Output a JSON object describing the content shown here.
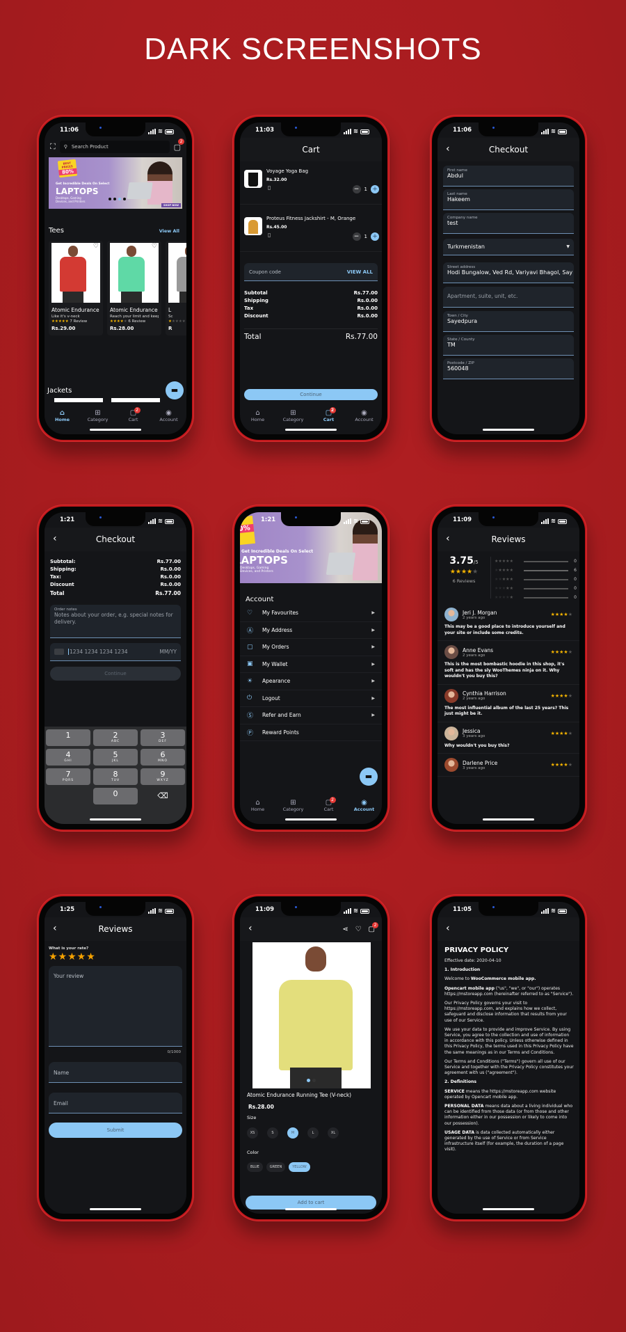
{
  "title": "DARK SCREENSHOTS",
  "colors": {
    "background": "#a81c1f",
    "accent": "#8cc8f5",
    "badge": "#e53935",
    "star": "#f5b400"
  },
  "nav": {
    "home": "Home",
    "category": "Category",
    "cart": "Cart",
    "account": "Account",
    "cart_badge": "2"
  },
  "home": {
    "time": "11:06",
    "search_placeholder": "Search Product",
    "cart_badge": "2",
    "banner": {
      "tag": "BEST PRICES",
      "discount": "80%",
      "headline": "Get Incredible Deals On Select",
      "title": "LAPTOPS",
      "sub": "Desktops, Gaming Devices, and Printers",
      "cta": "SHOP NOW",
      "active_dot": 3,
      "dots": 4
    },
    "section_tees": "Tees",
    "view_all": "View All",
    "section_jackets": "Jackets",
    "products": [
      {
        "name": "Atomic Endurance",
        "desc": "Like it's v-neck",
        "rating": 4.5,
        "reviews": "7 Review",
        "price": "Rs.29.00",
        "color": "#d33a33"
      },
      {
        "name": "Atomic Endurance",
        "desc": "Reach your limit and keep",
        "rating": 4,
        "reviews": "6 Review",
        "price": "Rs.28.00",
        "color": "#5fd9a6"
      },
      {
        "name": "L",
        "desc": "Sc",
        "rating": 1,
        "reviews": "",
        "price": "R",
        "color": "#999"
      }
    ]
  },
  "cart": {
    "time": "11:03",
    "title": "Cart",
    "items": [
      {
        "name": "Voyage Yoga Bag",
        "price": "Rs.32.00",
        "qty": "1"
      },
      {
        "name": "Proteus Fitness Jackshirt - M, Orange",
        "price": "Rs.45.00",
        "qty": "1"
      }
    ],
    "coupon_placeholder": "Coupon code",
    "coupon_view_all": "VIEW ALL",
    "summary": [
      {
        "label": "Subtotal",
        "value": "Rs.77.00"
      },
      {
        "label": "Shipping",
        "value": "Rs.0.00"
      },
      {
        "label": "Tax",
        "value": "Rs.0.00"
      },
      {
        "label": "Discount",
        "value": "Rs.0.00"
      }
    ],
    "total_label": "Total",
    "total_value": "Rs.77.00",
    "continue": "Continue"
  },
  "checkout_address": {
    "time": "11:06",
    "title": "Checkout",
    "fields": [
      {
        "label": "First name",
        "value": "Abdul"
      },
      {
        "label": "Last name",
        "value": "Hakeem"
      },
      {
        "label": "Company name",
        "value": "test"
      }
    ],
    "country": "Turkmenistan",
    "street_label": "Street address",
    "street_value": "Hodi Bungalow, Ved Rd, Variyavi Bhagol, Say",
    "apartment_placeholder": "Apartment, suite, unit, etc.",
    "fields2": [
      {
        "label": "Town / City",
        "value": "Sayedpura"
      },
      {
        "label": "State / County",
        "value": "TM"
      },
      {
        "label": "Postcode / ZIP",
        "value": "560048"
      }
    ]
  },
  "checkout_payment": {
    "time": "1:21",
    "title": "Checkout",
    "summary": [
      {
        "label": "Subtotal:",
        "value": "Rs.77.00"
      },
      {
        "label": "Shipping:",
        "value": "Rs.0.00"
      },
      {
        "label": "Tax:",
        "value": "Rs.0.00"
      },
      {
        "label": "Discount",
        "value": "Rs.0.00"
      },
      {
        "label": "Total",
        "value": "Rs.77.00"
      }
    ],
    "notes_label": "Order notes",
    "notes_placeholder": "Notes about your order, e.g. special notes for delivery.",
    "card_placeholder": "1234 1234 1234 1234",
    "expiry_placeholder": "MM/YY",
    "continue": "Continue",
    "keys": [
      [
        {
          "n": "1",
          "l": ""
        },
        {
          "n": "2",
          "l": "ABC"
        },
        {
          "n": "3",
          "l": "DEF"
        }
      ],
      [
        {
          "n": "4",
          "l": "GHI"
        },
        {
          "n": "5",
          "l": "JKL"
        },
        {
          "n": "6",
          "l": "MNO"
        }
      ],
      [
        {
          "n": "7",
          "l": "PQRS"
        },
        {
          "n": "8",
          "l": "TUV"
        },
        {
          "n": "9",
          "l": "WXYZ"
        }
      ],
      [
        {
          "n": "",
          "l": ""
        },
        {
          "n": "0",
          "l": ""
        },
        {
          "n": "⌫",
          "l": ""
        }
      ]
    ]
  },
  "account": {
    "time": "1:21",
    "heading": "Account",
    "items": [
      {
        "label": "My Favourites",
        "icon": "heart-icon",
        "glyph": "♡"
      },
      {
        "label": "My Address",
        "icon": "address-icon",
        "glyph": "Ⓐ"
      },
      {
        "label": "My Orders",
        "icon": "bag-icon",
        "glyph": "▢"
      },
      {
        "label": "My Wallet",
        "icon": "wallet-icon",
        "glyph": "▣"
      },
      {
        "label": "Apearance",
        "icon": "sun-icon",
        "glyph": "☀"
      },
      {
        "label": "Logout",
        "icon": "power-icon",
        "glyph": "⏻"
      },
      {
        "label": "Refer and Earn",
        "icon": "dollar-icon",
        "glyph": "Ⓢ"
      },
      {
        "label": "Reward Points",
        "icon": "points-icon",
        "glyph": "Ⓟ"
      }
    ]
  },
  "reviews_list": {
    "time": "11:09",
    "title": "Reviews",
    "average": "3.75",
    "out_of": "/5",
    "average_stars": 4,
    "count_label": "6 Reviews",
    "distribution": [
      {
        "stars": 5,
        "count": "0",
        "fraction": 0
      },
      {
        "stars": 4,
        "count": "6",
        "fraction": 1
      },
      {
        "stars": 3,
        "count": "0",
        "fraction": 0
      },
      {
        "stars": 2,
        "count": "0",
        "fraction": 0
      },
      {
        "stars": 1,
        "count": "0",
        "fraction": 0
      }
    ],
    "reviews": [
      {
        "name": "Jeri J. Morgan",
        "ago": "2 years ago",
        "rating": 3.5,
        "text": "This may be a good place to introduce yourself and your site or include some credits."
      },
      {
        "name": "Anne Evans",
        "ago": "2 years ago",
        "rating": 4,
        "text": "This is the most bombastic hoodie in this shop, it's soft and has the sly WooThemes ninja on it. Why wouldn't you buy this?"
      },
      {
        "name": "Cynthia Harrison",
        "ago": "2 years ago",
        "rating": 3.5,
        "text": "The most influential album of the last 25 years? This just might be it."
      },
      {
        "name": "Jessica",
        "ago": "3 years ago",
        "rating": 4,
        "text": "Why wouldn't you buy this?"
      },
      {
        "name": "Darlene Price",
        "ago": "3 years ago",
        "rating": 3.5,
        "text": ""
      }
    ]
  },
  "review_form": {
    "time": "1:25",
    "title": "Reviews",
    "rate_label": "What is your rate?",
    "rating": 5,
    "review_placeholder": "Your review",
    "counter": "0/1000",
    "name_placeholder": "Name",
    "email_placeholder": "Email",
    "submit": "Submit"
  },
  "product": {
    "time": "11:09",
    "cart_badge": "2",
    "name": "Atomic Endurance Running Tee (V-neck)",
    "price": "Rs.28.00",
    "size_label": "Size",
    "sizes": [
      "XS",
      "S",
      "M",
      "L",
      "XL"
    ],
    "selected_size": "M",
    "color_label": "Color",
    "colors": [
      "BLUE",
      "GREEN",
      "YELLOW"
    ],
    "selected_color": "YELLOW",
    "add_to_cart": "Add to cart"
  },
  "privacy": {
    "time": "11:05",
    "title": "PRIVACY POLICY",
    "paragraphs": [
      {
        "bold": "",
        "text": "Effective date: 2020-04-10"
      },
      {
        "bold": "1. Introduction",
        "text": ""
      },
      {
        "bold": "",
        "text": "Welcome to ",
        "bold2": "WooCommerce mobile app."
      },
      {
        "bold": "Opencart mobile app",
        "text": " (\"us\", \"we\", or \"our\") operates https://mstoreapp.com (hereinafter referred to as \"Service\")."
      },
      {
        "bold": "",
        "text": "Our Privacy Policy governs your visit to https://mstoreapp.com, and explains how we collect, safeguard and disclose information that results from your use of our Service."
      },
      {
        "bold": "",
        "text": "We use your data to provide and improve Service. By using Service, you agree to the collection and use of information in accordance with this policy. Unless otherwise defined in this Privacy Policy, the terms used in this Privacy Policy have the same meanings as in our Terms and Conditions."
      },
      {
        "bold": "",
        "text": "Our Terms and Conditions (\"Terms\") govern all use of our Service and together with the Privacy Policy constitutes your agreement with us (\"agreement\")."
      },
      {
        "bold": "2. Definitions",
        "text": ""
      },
      {
        "bold": "SERVICE",
        "text": " means the https://mstoreapp.com website operated by Opencart mobile app."
      },
      {
        "bold": "PERSONAL DATA",
        "text": " means data about a living individual who can be identified from those data (or from those and other information either in our possession or likely to come into our possession)."
      },
      {
        "bold": "USAGE DATA",
        "text": " is data collected automatically either generated by the use of Service or from Service infrastructure itself (for example, the duration of a page visit)."
      }
    ]
  }
}
